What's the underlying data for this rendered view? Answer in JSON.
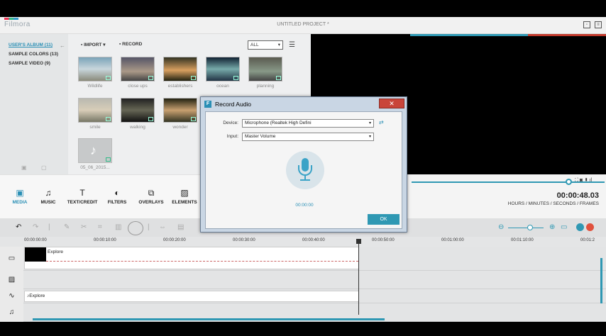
{
  "titlebar": {
    "logo": "Filmora",
    "project_title": "UNTITLED PROJECT *"
  },
  "albums": [
    {
      "label": "USER'S ALBUM (11)"
    },
    {
      "label": "SAMPLE COLORS (13)"
    },
    {
      "label": "SAMPLE VIDEO (9)"
    }
  ],
  "media_toolbar": {
    "import_label": "IMPORT",
    "record_label": "RECORD",
    "filter_value": "ALL"
  },
  "thumbnails": [
    {
      "label": "Wildlife"
    },
    {
      "label": "close ups"
    },
    {
      "label": "establishers"
    },
    {
      "label": "ocean"
    },
    {
      "label": "planning"
    },
    {
      "label": "smile"
    },
    {
      "label": "walking"
    },
    {
      "label": "wonder"
    },
    {
      "label": "05_06_2015..."
    }
  ],
  "tabs": [
    {
      "label": "MEDIA",
      "icon": "media-icon"
    },
    {
      "label": "MUSIC",
      "icon": "music-note-icon"
    },
    {
      "label": "TEXT/CREDIT",
      "icon": "text-icon"
    },
    {
      "label": "FILTERS",
      "icon": "filters-icon"
    },
    {
      "label": "OVERLAYS",
      "icon": "overlays-icon"
    },
    {
      "label": "ELEMENTS",
      "icon": "elements-icon"
    }
  ],
  "player": {
    "timecode": "00:00:48.03",
    "timecode_units": "HOURS / MINUTES / SECONDS / FRAMES"
  },
  "ruler": [
    "00:00:00:00",
    "00:00:10:00",
    "00:00:20:00",
    "00:00:30:00",
    "00:00:40:00",
    "00:00:50:00",
    "00:01:00:00",
    "00:01:10:00",
    "00:01:2"
  ],
  "timeline": {
    "video_clip_label": "Explore",
    "audio_clip_label": "Explore"
  },
  "dialog": {
    "title": "Record Audio",
    "device_label": "Device:",
    "device_value": "Microphone (Realtek High Defini",
    "input_label": "Input:",
    "input_value": "Master Volume",
    "record_time": "00:00:00",
    "ok_label": "OK"
  },
  "colors": {
    "accent": "#2f98b3",
    "close": "#c9453a"
  }
}
